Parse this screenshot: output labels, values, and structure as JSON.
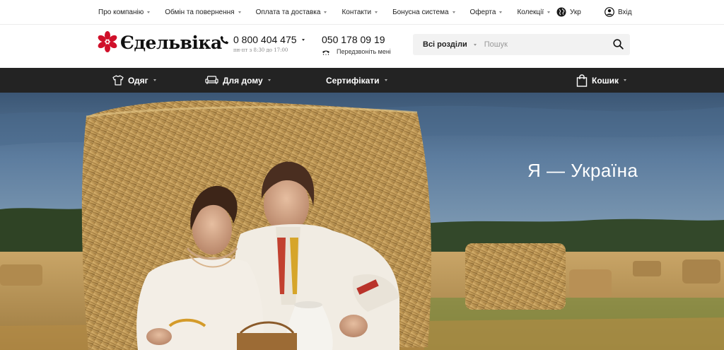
{
  "topbar": {
    "items": [
      {
        "label": "Про компанію"
      },
      {
        "label": "Обмін та повернення"
      },
      {
        "label": "Оплата та доставка"
      },
      {
        "label": "Контакти"
      },
      {
        "label": "Бонусна система"
      },
      {
        "label": "Оферта"
      },
      {
        "label": "Колекції"
      }
    ],
    "language": "Укр",
    "login": "Вхід"
  },
  "header": {
    "logo_text": "Єдельвіка",
    "phone_main": "0 800 404 475",
    "phone_hours": "пн-пт з 8:30 до 17:00",
    "phone_second": "050 178 09 19",
    "callback": "Передзвоніть мені",
    "search": {
      "section": "Всі розділи",
      "placeholder": "Пошук"
    }
  },
  "mainnav": {
    "clothing": "Одяг",
    "home": "Для дому",
    "certificates": "Сертифікати",
    "cart": "Кошик"
  },
  "hero": {
    "title": "Я  — Україна"
  },
  "colors": {
    "brand_red": "#d0102a",
    "nav_dark": "#232323",
    "search_bg": "#f2f2f2"
  },
  "icons": [
    "edelweiss-logo-icon",
    "globe-icon",
    "user-icon",
    "phone-icon",
    "callback-icon",
    "search-icon",
    "shirt-icon",
    "sofa-icon",
    "cart-bag-icon"
  ]
}
